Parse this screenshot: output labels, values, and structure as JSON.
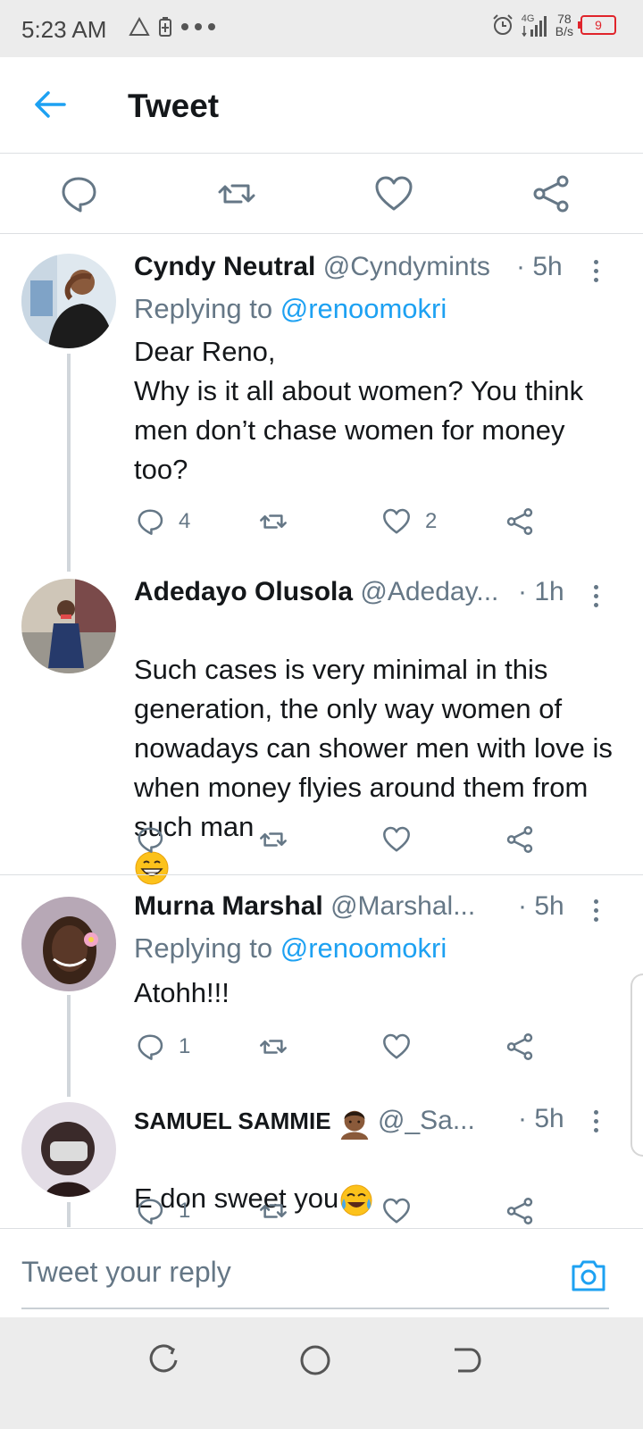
{
  "status_bar": {
    "time": "5:23 AM",
    "network_type": "4G",
    "net_speed_value": "78",
    "net_speed_unit": "B/s",
    "battery": "9"
  },
  "header": {
    "title": "Tweet"
  },
  "tweets": [
    {
      "name": "Cyndy Neutral",
      "handle": "@Cyndymints",
      "time": "· 5h",
      "replying_prefix": "Replying to ",
      "replying_to": "@renoomokri",
      "body": "Dear Reno,\nWhy is it all about women? You think men don’t chase women for money too?",
      "replies": "4",
      "retweets": "",
      "likes": "2"
    },
    {
      "name": "Adedayo Olusola",
      "handle": "@Adeday...",
      "time": "· 1h",
      "body": "Such cases is very minimal in this generation,  the only way women of nowadays can shower men with love is when money flyies around them from such man",
      "emoji": "grinning-face-emoji",
      "replies": "",
      "retweets": "",
      "likes": ""
    },
    {
      "name": "Murna Marshal",
      "handle": "@Marshal...",
      "time": "· 5h",
      "replying_prefix": "Replying to ",
      "replying_to": "@renoomokri",
      "body": "Atohh!!!",
      "replies": "1",
      "retweets": "",
      "likes": ""
    },
    {
      "name": "SAMUEL SAMMIE",
      "handle": "@_Sa...",
      "time": "· 5h",
      "body": "E don sweet you",
      "emoji": "tears-of-joy-emoji",
      "replies": "1",
      "retweets": "",
      "likes": ""
    }
  ],
  "composer": {
    "placeholder": "Tweet your reply"
  },
  "colors": {
    "accent": "#1da1f2",
    "text_primary": "#14171a",
    "text_secondary": "#657786",
    "divider": "#dcdfe2",
    "battery_low": "#e0242b"
  }
}
